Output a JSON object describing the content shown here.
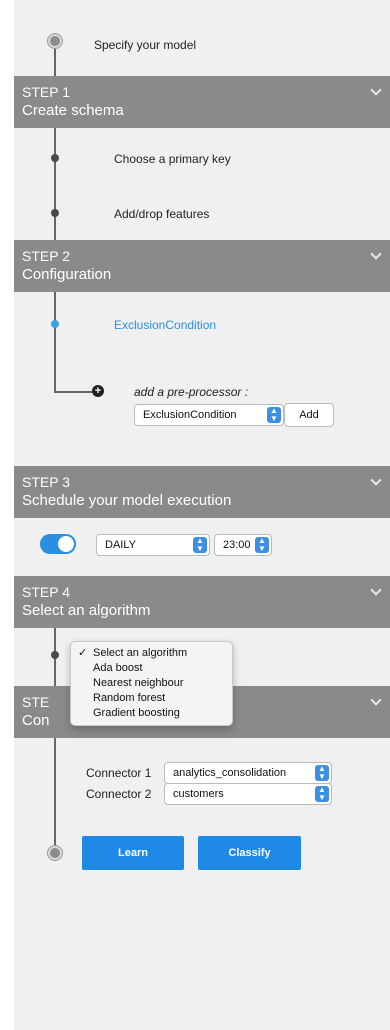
{
  "intro": {
    "label": "Specify your model"
  },
  "step1": {
    "num": "STEP 1",
    "title": "Create schema",
    "items": [
      "Choose a primary key",
      "Add/drop features"
    ]
  },
  "step2": {
    "num": "STEP 2",
    "title": "Configuration",
    "item": "ExclusionCondition",
    "preproc_label": "add a pre-processor :",
    "preproc_value": "ExclusionCondition",
    "add_label": "Add"
  },
  "step3": {
    "num": "STEP 3",
    "title": "Schedule your model execution",
    "toggle_on": true,
    "frequency": "DAILY",
    "time": "23:00"
  },
  "step4": {
    "num": "STEP 4",
    "title": "Select an algorithm",
    "dropdown_options": [
      "Select an algorithm",
      "Ada boost",
      "Nearest neighbour",
      "Random forest",
      "Gradient boosting"
    ],
    "selected_index": 0,
    "checkmark": "✓"
  },
  "step5": {
    "num_partial": "STE",
    "title_partial": "Con",
    "connectors": [
      {
        "label": "Connector 1",
        "value": "analytics_consolidation"
      },
      {
        "label": "Connector 2",
        "value": "customers"
      }
    ]
  },
  "actions": {
    "learn": "Learn",
    "classify": "Classify"
  },
  "colors": {
    "accent": "#1e88e5",
    "step_header": "#8a8a8a",
    "panel_bg": "#f0f0f0"
  },
  "icons": {
    "chevron": "chevron-down-icon",
    "stepper": "up-down-stepper-icon",
    "plus": "plus-icon"
  }
}
